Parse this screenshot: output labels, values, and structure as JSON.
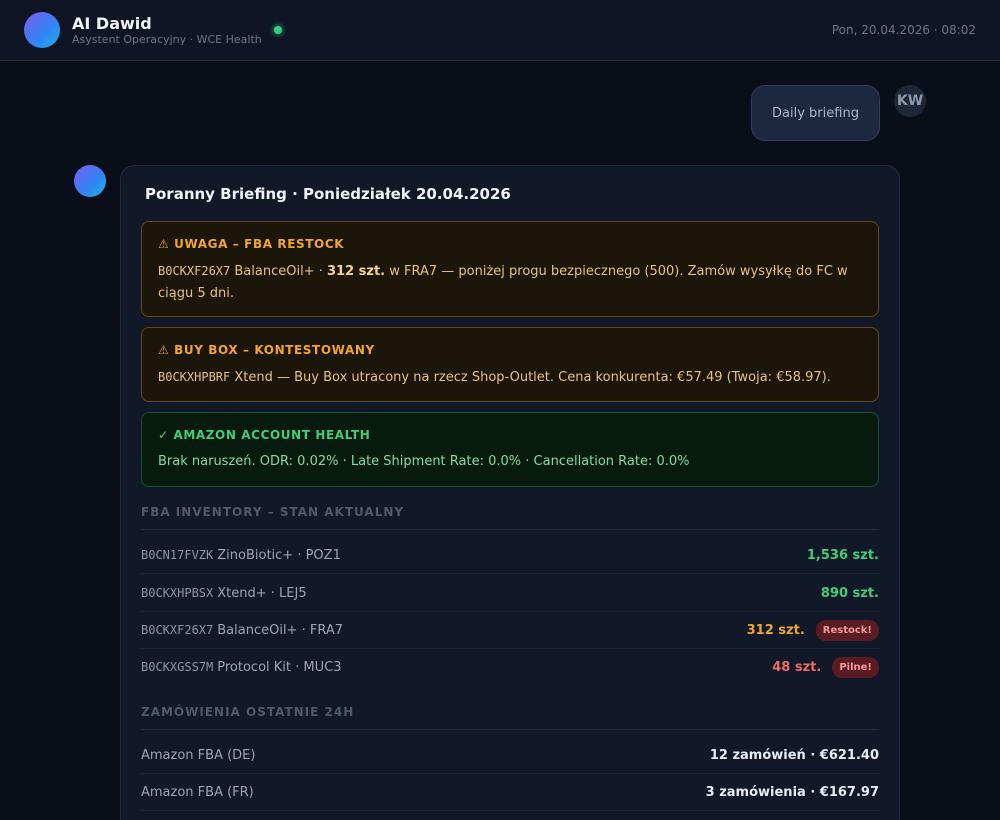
{
  "header": {
    "brand_icon": "robot-icon",
    "brand_glyph": "",
    "title": "AI Dawid",
    "subtitle": "Asystent Operacyjny · WCE Health",
    "status_color": "#35d07f",
    "datetime": "Pon, 20.04.2026 · 08:02"
  },
  "user_message": {
    "text": "Daily briefing",
    "avatar_initials": "KW"
  },
  "bot_message": {
    "avatar_glyph": "",
    "title_glyph": "",
    "title": "Poranny Briefing · Poniedziałek 20.04.2026",
    "alerts": [
      {
        "icon": "⚠",
        "title": "UWAGA – FBA RESTOCK",
        "sku": "B0CKXF26X7",
        "text_before": " BalanceOil+ · ",
        "bold": "312 szt.",
        "text_after": " w FRA7 — poniżej progu bezpiecznego (500). Zamów wysyłkę do FC w ciągu 5 dni."
      },
      {
        "icon": "⚠",
        "title": "BUY BOX – KONTESTOWANY",
        "sku": "B0CKXHPBRF",
        "text_after": " Xtend — Buy Box utracony na rzecz Shop-Outlet. Cena konkurenta: €57.49 (Twoja: €58.97)."
      },
      {
        "icon": "✓",
        "title": "AMAZON ACCOUNT HEALTH",
        "text": "Brak naruszeń. ODR: 0.02% · Late Shipment Rate: 0.0% · Cancellation Rate: 0.0%"
      }
    ],
    "inventory": {
      "icon": "",
      "title": "FBA INVENTORY – STAN AKTUALNY",
      "rows": [
        {
          "sku": "B0CN17FVZK",
          "name": "ZinoBiotic+ · POZ1",
          "qty": "1,536 szt."
        },
        {
          "sku": "B0CKXHPBSX",
          "name": "Xtend+ · LEJ5",
          "qty": "890 szt."
        },
        {
          "sku": "B0CKXF26X7",
          "name": "BalanceOil+ · FRA7",
          "qty": "312 szt.",
          "badge": "Restock!"
        },
        {
          "sku": "B0CKXGSS7M",
          "name": "Protocol Kit · MUC3",
          "qty": "48 szt.",
          "badge": "Pilne!"
        }
      ]
    },
    "orders": {
      "icon": "",
      "title": "ZAMÓWIENIA OSTATNIE 24H",
      "rows": [
        {
          "channel": "Amazon FBA (DE)",
          "summary": "12 zamówień · €621.40"
        },
        {
          "channel": "Amazon FBA (FR)",
          "summary": "3 zamówienia · €167.97"
        }
      ]
    }
  }
}
